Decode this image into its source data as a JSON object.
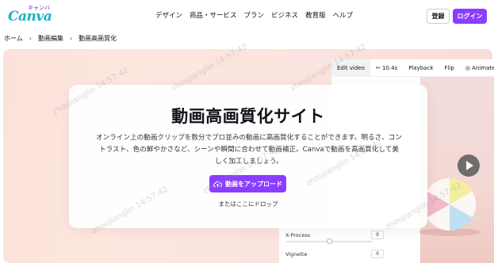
{
  "header": {
    "logo_text": "Canva",
    "logo_kana": "キャンバ",
    "nav": [
      "デザイン",
      "商品・サービス",
      "プラン",
      "ビジネス",
      "教育版",
      "ヘルプ"
    ],
    "login_label": "登録",
    "signup_label": "ログイン"
  },
  "breadcrumb": [
    "ホーム",
    "動画編集",
    "動画高画質化"
  ],
  "editor": {
    "toolbar": [
      "Edit video",
      "10.4s",
      "Playback",
      "Flip",
      "Animate"
    ],
    "panel_rows": [
      {
        "label": "X-Process",
        "value": "0"
      },
      {
        "label": "Vignette",
        "value": "0"
      }
    ]
  },
  "card": {
    "title": "動画高画質化サイト",
    "description": "オンライン上の動画クリップを数分でプロ並みの動画に高画質化することができます。明るさ、コントラスト、色の鮮やかさなど、シーンや瞬間に合わせて動画補正。Canvaで動画を高画質化して美しく加工しましょう。",
    "upload_label": "動画をアップロード",
    "drop_label": "またはここにドロップ"
  },
  "watermark": "zhoujianglin 14:57:42",
  "colors": {
    "brand": "#8b3dff",
    "logo": "#17b3c4"
  }
}
